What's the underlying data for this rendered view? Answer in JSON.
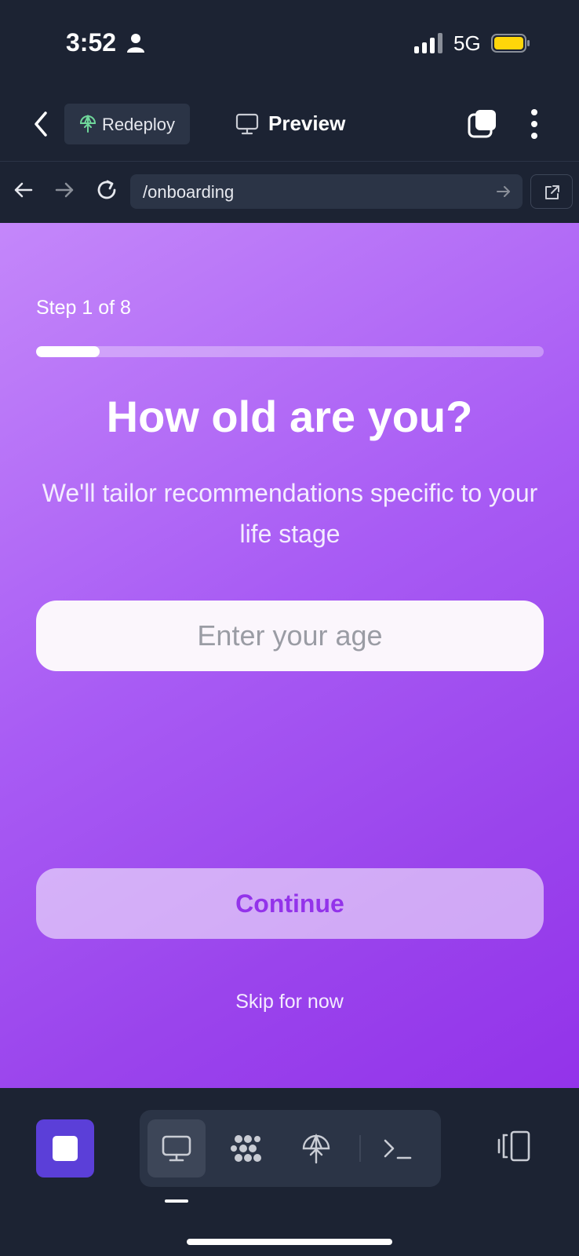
{
  "status_bar": {
    "time": "3:52",
    "network": "5G",
    "icons": [
      "person-icon",
      "signal-icon",
      "battery-icon"
    ]
  },
  "header": {
    "redeploy_label": "Redeploy",
    "preview_label": "Preview",
    "icons": [
      "chevron-left-icon",
      "redeploy-icon",
      "monitor-icon",
      "tabs-icon",
      "kebab-menu-icon"
    ]
  },
  "url_bar": {
    "url": "/onboarding",
    "icons": [
      "arrow-left-icon",
      "arrow-right-icon",
      "reload-icon",
      "arrow-go-icon",
      "open-external-icon"
    ]
  },
  "onboarding": {
    "step_label": "Step 1 of 8",
    "progress_fraction": 0.125,
    "question": "How old are you?",
    "subtitle": "We'll tailor recommendations specific to your life stage",
    "age_placeholder": "Enter your age",
    "age_value": "",
    "continue_label": "Continue",
    "skip_label": "Skip for now"
  },
  "colors": {
    "app_background": "#1c2333",
    "gradient_start": "#c487fa",
    "gradient_end": "#9333ea",
    "accent": "#9333ea",
    "stop_button": "#5b3fd8",
    "redeploy_icon": "#6fd69a"
  },
  "bottom_bar": {
    "tools": [
      "monitor-icon",
      "packages-icon",
      "deploy-icon",
      "terminal-icon"
    ],
    "active_tool": "monitor-icon",
    "icons": [
      "stop-icon",
      "layout-toggle-icon"
    ]
  }
}
